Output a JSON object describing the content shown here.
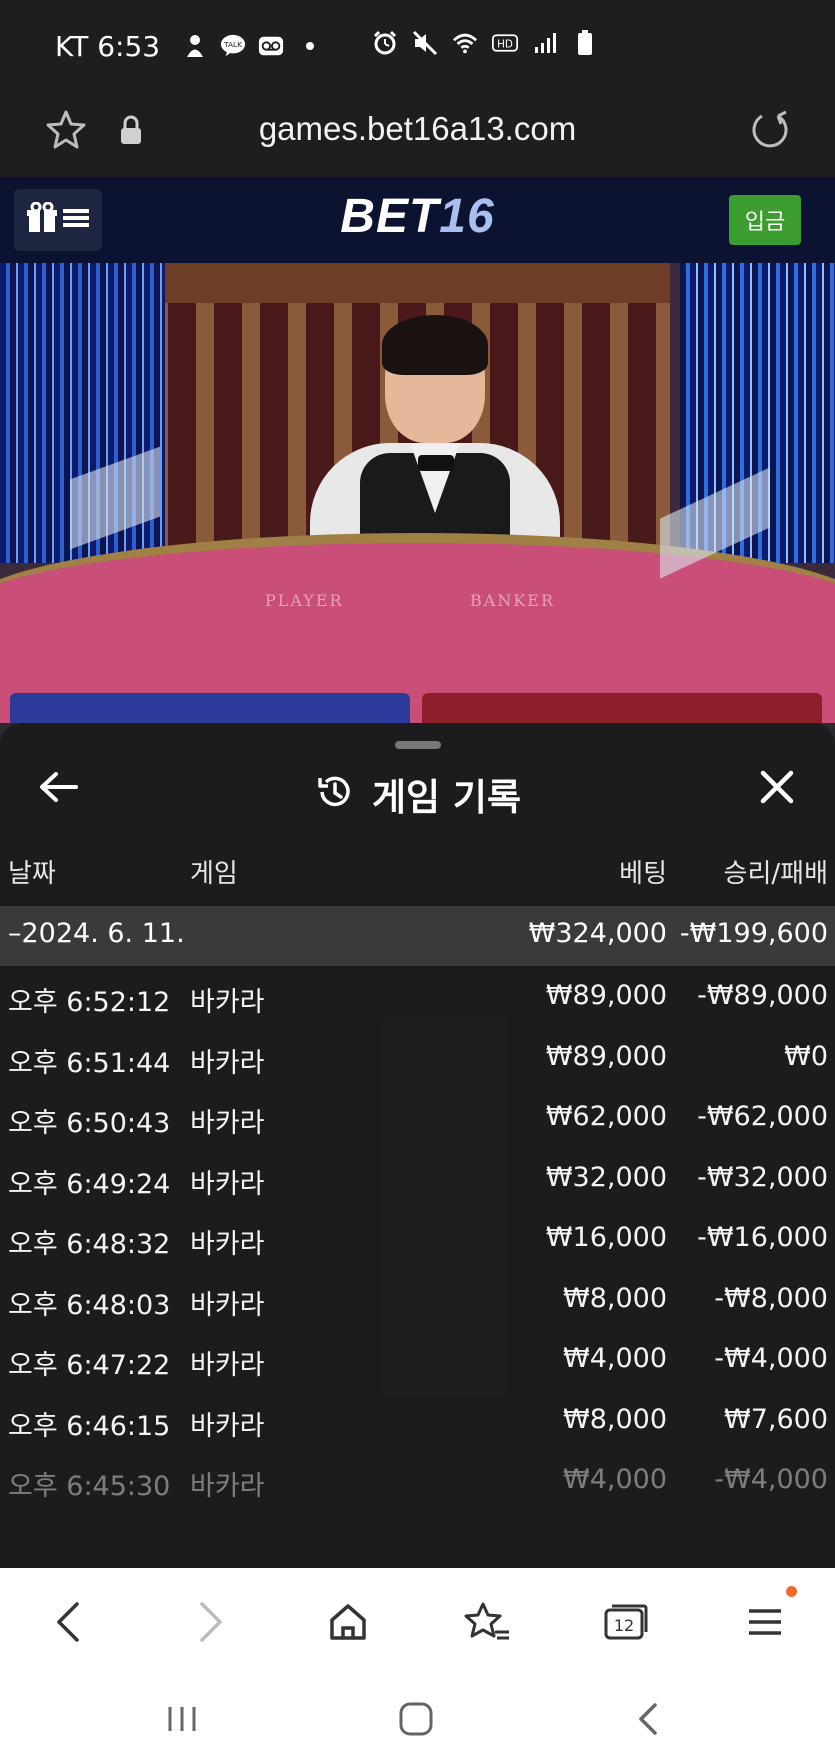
{
  "status_bar": {
    "carrier_time": "KT 6:53",
    "icons_left": [
      "person-icon",
      "kakaotalk-icon",
      "voicemail-icon"
    ],
    "icons_right": [
      "alarm-icon",
      "mute-icon",
      "wifi-icon",
      "hd-icon",
      "signal-icon",
      "battery-icon"
    ],
    "hd_label": "HD",
    "talk_label": "TALK"
  },
  "url_bar": {
    "url": "games.bet16a13.com"
  },
  "site_header": {
    "logo_bet": "BET",
    "logo_num": "16",
    "deposit_label": "입금"
  },
  "video": {
    "table_player": "PLAYER",
    "table_banker": "BANKER"
  },
  "history_sheet": {
    "title": "게임 기록",
    "columns": {
      "date": "날짜",
      "game": "게임",
      "bet": "베팅",
      "result": "승리/패배"
    },
    "group": {
      "date": "–2024. 6. 11.",
      "bet_total": "₩324,000",
      "result_total": "-₩199,600"
    },
    "rows": [
      {
        "time": "오후 6:52:12",
        "game": "바카라",
        "bet": "₩89,000",
        "result": "-₩89,000"
      },
      {
        "time": "오후 6:51:44",
        "game": "바카라",
        "bet": "₩89,000",
        "result": "₩0"
      },
      {
        "time": "오후 6:50:43",
        "game": "바카라",
        "bet": "₩62,000",
        "result": "-₩62,000"
      },
      {
        "time": "오후 6:49:24",
        "game": "바카라",
        "bet": "₩32,000",
        "result": "-₩32,000"
      },
      {
        "time": "오후 6:48:32",
        "game": "바카라",
        "bet": "₩16,000",
        "result": "-₩16,000"
      },
      {
        "time": "오후 6:48:03",
        "game": "바카라",
        "bet": "₩8,000",
        "result": "-₩8,000"
      },
      {
        "time": "오후 6:47:22",
        "game": "바카라",
        "bet": "₩4,000",
        "result": "-₩4,000"
      },
      {
        "time": "오후 6:46:15",
        "game": "바카라",
        "bet": "₩8,000",
        "result": "₩7,600"
      },
      {
        "time": "오후 6:45:30",
        "game": "바카라",
        "bet": "₩4,000",
        "result": "-₩4,000"
      }
    ]
  },
  "browser_nav": {
    "tab_count": "12",
    "items": [
      "back-icon",
      "forward-icon",
      "home-icon",
      "bookmarks-icon",
      "tabs-icon",
      "menu-icon"
    ]
  },
  "system_nav": {
    "items": [
      "recents-icon",
      "home-icon",
      "back-icon"
    ]
  },
  "colors": {
    "deposit_green": "#3b9d2f",
    "header_navy": "#0b1330",
    "notification_orange": "#f26a2b"
  }
}
